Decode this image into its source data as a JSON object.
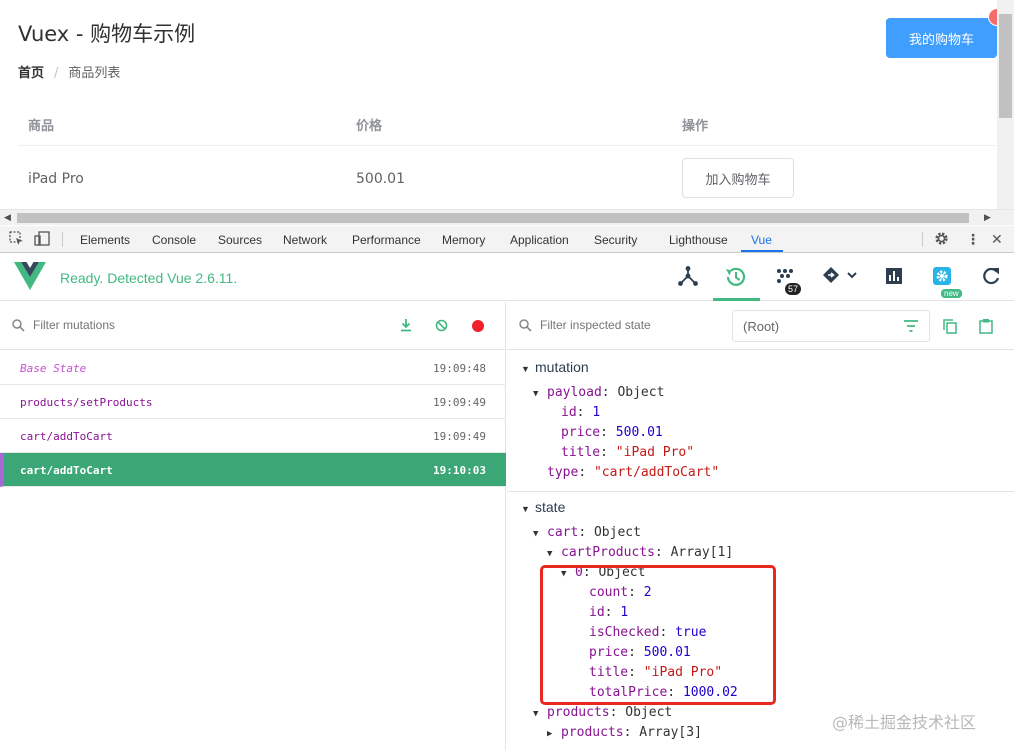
{
  "page": {
    "title": "Vuex - 购物车示例",
    "breadcrumb": {
      "home": "首页",
      "separator": "/",
      "current": "商品列表"
    },
    "cart_button": "我的购物车",
    "table": {
      "headers": [
        "商品",
        "价格",
        "操作"
      ],
      "rows": [
        {
          "name": "iPad Pro",
          "price": "500.01",
          "action": "加入购物车"
        }
      ]
    }
  },
  "devtools": {
    "tabs": [
      "Elements",
      "Console",
      "Sources",
      "Network",
      "Performance",
      "Memory",
      "Application",
      "Security",
      "Lighthouse",
      "Vue"
    ],
    "active_tab": "Vue"
  },
  "vue": {
    "status": "Ready. Detected Vue 2.6.11.",
    "perf_count": "57",
    "new_badge": "new",
    "accent": "#42b983"
  },
  "mutations": {
    "placeholder": "Filter mutations",
    "items": [
      {
        "name": "Base State",
        "time": "19:09:48"
      },
      {
        "name": "products/setProducts",
        "time": "19:09:49"
      },
      {
        "name": "cart/addToCart",
        "time": "19:09:49"
      },
      {
        "name": "cart/addToCart",
        "time": "19:10:03"
      }
    ]
  },
  "inspector": {
    "placeholder": "Filter inspected state",
    "root": "(Root)",
    "mutation_section": "mutation",
    "state_section": "state",
    "mutation": {
      "payload_key": "payload",
      "payload_type": "Object",
      "id": "1",
      "price": "500.01",
      "title": "\"iPad Pro\"",
      "type_key": "type",
      "type": "\"cart/addToCart\""
    },
    "state": {
      "cart_key": "cart",
      "cart_type": "Object",
      "cartProducts_key": "cartProducts",
      "cartProducts_type": "Array[1]",
      "item_key": "0",
      "item_type": "Object",
      "count": "2",
      "id": "1",
      "isChecked": "true",
      "price": "500.01",
      "title": "\"iPad Pro\"",
      "totalPrice": "1000.02",
      "products_key": "products",
      "products_type": "Object",
      "products_products_key": "products",
      "products_products_type": "Array[3]"
    }
  },
  "watermark": "@稀土掘金技术社区"
}
